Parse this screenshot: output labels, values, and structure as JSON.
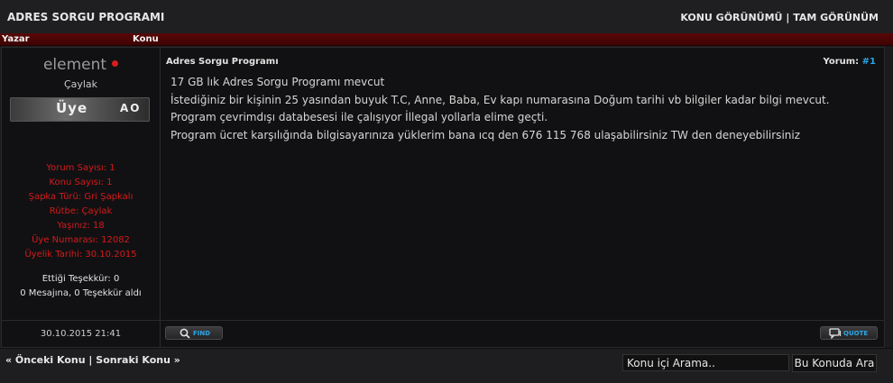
{
  "header": {
    "title": "ADRES SORGU PROGRAMI",
    "view_threaded": "KONU GÖRÜNÜMÜ",
    "separator": "|",
    "view_full": "TAM GÖRÜNÜM"
  },
  "columns": {
    "author": "Yazar",
    "topic": "Konu"
  },
  "post": {
    "author": {
      "username": "element",
      "rank": "Çaylak",
      "badge_text": "Üye",
      "badge_tag": "AO",
      "stats": [
        "Yorum Sayısı: 1",
        "Konu Sayısı: 1",
        "Şapka Türü: Gri Şapkalı",
        "Rütbe: Çaylak",
        "Yaşınız: 18",
        "Üye Numarası: 12082",
        "Üyelik Tarihi: 30.10.2015"
      ],
      "thanks_given": "Ettiği Teşekkür: 0",
      "thanks_received": "0 Mesajına, 0 Teşekkür aldı"
    },
    "title": "Adres Sorgu Programı",
    "number_label": "Yorum:",
    "number": "#1",
    "lines": [
      "17 GB lık Adres Sorgu Programı mevcut",
      "İstediğiniz bir kişinin 25 yasından buyuk T.C, Anne, Baba, Ev kapı numarasına Doğum tarihi vb bilgiler kadar bilgi mevcut.",
      "Program çevrimdışı databesesi ile çalışıyor İllegal yollarla elime geçti.",
      "Program ücret karşılığında bilgisayarınıza yüklerim bana ıcq den 676 115 768 ulaşabilirsiniz TW den deneyebilirsiniz"
    ],
    "date": "30.10.2015 21:41",
    "find_label": "FIND",
    "quote_label": "QUOTE"
  },
  "footer": {
    "prev": "« Önceki Konu",
    "separator": "|",
    "next": "Sonraki Konu »",
    "search_value": "Konu içi Arama..",
    "search_button": "Bu Konuda Ara"
  },
  "colors": {
    "accent_red": "#d41a1a",
    "accent_blue": "#2aa6e6",
    "header_bar": "#5a0707"
  }
}
